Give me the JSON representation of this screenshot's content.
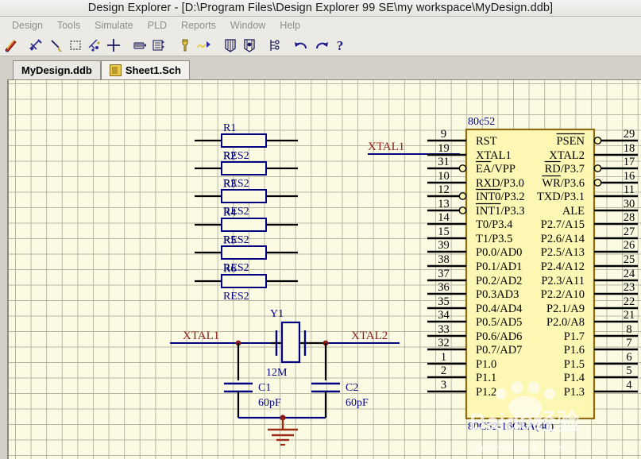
{
  "window": {
    "title": "Design Explorer - [D:\\Program Files\\Design Explorer 99 SE\\my workspace\\MyDesign.ddb]"
  },
  "menubar": {
    "items": [
      {
        "label": "Design"
      },
      {
        "label": "Tools"
      },
      {
        "label": "Simulate"
      },
      {
        "label": "PLD"
      },
      {
        "label": "Reports"
      },
      {
        "label": "Window"
      },
      {
        "label": "Help"
      }
    ]
  },
  "toolbar": {
    "buttons": [
      {
        "name": "wiring-pen-icon"
      },
      {
        "name": "place-wire-icon"
      },
      {
        "name": "place-line-icon"
      },
      {
        "name": "selection-rectangle-icon"
      },
      {
        "name": "place-junction-icon"
      },
      {
        "name": "move-crosshair-icon"
      },
      {
        "name": "netlist-icon"
      },
      {
        "name": "simulation-setup-icon"
      },
      {
        "name": "probe-icon"
      },
      {
        "name": "waveform-icon"
      },
      {
        "name": "pld-compile-icon"
      },
      {
        "name": "pld-download-icon"
      },
      {
        "name": "hierarchy-icon"
      },
      {
        "name": "undo-icon"
      },
      {
        "name": "redo-icon"
      },
      {
        "name": "help-icon"
      }
    ]
  },
  "tabs": [
    {
      "label": "MyDesign.ddb",
      "icon": "",
      "active": false
    },
    {
      "label": "Sheet1.Sch",
      "icon": "schematic-icon",
      "active": true
    }
  ],
  "schematic": {
    "resistors": [
      {
        "designator": "R1",
        "value": "RES2"
      },
      {
        "designator": "R2",
        "value": "RES2"
      },
      {
        "designator": "R3",
        "value": "RES2"
      },
      {
        "designator": "R4",
        "value": "RES2"
      },
      {
        "designator": "R5",
        "value": "RES2"
      },
      {
        "designator": "R6",
        "value": "RES2"
      }
    ],
    "crystal": {
      "designator": "Y1",
      "value": "12M"
    },
    "capacitors": [
      {
        "designator": "C1",
        "value": "60pF"
      },
      {
        "designator": "C2",
        "value": "60pF"
      }
    ],
    "net_labels": [
      {
        "label": "XTAL1",
        "at": "mcu-pin-19"
      },
      {
        "label": "XTAL1",
        "at": "osc-left"
      },
      {
        "label": "XTAL2",
        "at": "osc-right"
      }
    ],
    "ic": {
      "designator": "80c52",
      "part_number": "80C52-16CBA(40)",
      "left_pins": [
        {
          "num": "9",
          "label": "RST",
          "overbar": "",
          "inverted": false
        },
        {
          "num": "19",
          "label": "XTAL1",
          "overbar": "",
          "inverted": false
        },
        {
          "num": "31",
          "label": "EA/VPP",
          "overbar": "EA",
          "inverted": true
        },
        {
          "num": "10",
          "label": "RXD/P3.0",
          "overbar": "",
          "inverted": false
        },
        {
          "num": "12",
          "label": "INT0/P3.2",
          "overbar": "INT0",
          "inverted": true
        },
        {
          "num": "13",
          "label": "INT1/P3.3",
          "overbar": "INT1",
          "inverted": true
        },
        {
          "num": "14",
          "label": "T0/P3.4",
          "overbar": "",
          "inverted": false
        },
        {
          "num": "15",
          "label": "T1/P3.5",
          "overbar": "",
          "inverted": false
        },
        {
          "num": "39",
          "label": "P0.0/AD0",
          "overbar": "",
          "inverted": false
        },
        {
          "num": "38",
          "label": "P0.1/AD1",
          "overbar": "",
          "inverted": false
        },
        {
          "num": "37",
          "label": "P0.2/AD2",
          "overbar": "",
          "inverted": false
        },
        {
          "num": "36",
          "label": "P0.3AD3",
          "overbar": "",
          "inverted": false
        },
        {
          "num": "35",
          "label": "P0.4/AD4",
          "overbar": "",
          "inverted": false
        },
        {
          "num": "34",
          "label": "P0.5/AD5",
          "overbar": "",
          "inverted": false
        },
        {
          "num": "33",
          "label": "P0.6/AD6",
          "overbar": "",
          "inverted": false
        },
        {
          "num": "32",
          "label": "P0.7/AD7",
          "overbar": "",
          "inverted": false
        },
        {
          "num": "1",
          "label": "P1.0",
          "overbar": "",
          "inverted": false
        },
        {
          "num": "2",
          "label": "P1.1",
          "overbar": "",
          "inverted": false
        },
        {
          "num": "3",
          "label": "P1.2",
          "overbar": "",
          "inverted": false
        }
      ],
      "right_pins": [
        {
          "num": "29",
          "label": "PSEN",
          "overbar": "PSEN",
          "inverted": true
        },
        {
          "num": "18",
          "label": "XTAL2",
          "overbar": "",
          "inverted": false
        },
        {
          "num": "17",
          "label": "RD/P3.7",
          "overbar": "RD",
          "inverted": true
        },
        {
          "num": "16",
          "label": "WR/P3.6",
          "overbar": "WR",
          "inverted": true
        },
        {
          "num": "11",
          "label": "TXD/P3.1",
          "overbar": "",
          "inverted": false
        },
        {
          "num": "30",
          "label": "ALE",
          "overbar": "",
          "inverted": false
        },
        {
          "num": "28",
          "label": "P2.7/A15",
          "overbar": "",
          "inverted": false
        },
        {
          "num": "27",
          "label": "P2.6/A14",
          "overbar": "",
          "inverted": false
        },
        {
          "num": "26",
          "label": "P2.5/A13",
          "overbar": "",
          "inverted": false
        },
        {
          "num": "25",
          "label": "P2.4/A12",
          "overbar": "",
          "inverted": false
        },
        {
          "num": "24",
          "label": "P2.3/A11",
          "overbar": "",
          "inverted": false
        },
        {
          "num": "23",
          "label": "P2.2/A10",
          "overbar": "",
          "inverted": false
        },
        {
          "num": "22",
          "label": "P2.1/A9",
          "overbar": "",
          "inverted": false
        },
        {
          "num": "21",
          "label": "P2.0/A8",
          "overbar": "",
          "inverted": false
        },
        {
          "num": "8",
          "label": "P1.7",
          "overbar": "",
          "inverted": false
        },
        {
          "num": "7",
          "label": "P1.6",
          "overbar": "",
          "inverted": false
        },
        {
          "num": "6",
          "label": "P1.5",
          "overbar": "",
          "inverted": false
        },
        {
          "num": "5",
          "label": "P1.4",
          "overbar": "",
          "inverted": false
        },
        {
          "num": "4",
          "label": "P1.3",
          "overbar": "",
          "inverted": false
        }
      ]
    },
    "watermark": {
      "main": "Baidu经验",
      "sub": "jingyan.baidu.com"
    }
  },
  "colors": {
    "canvas_bg": "#fbfbe4",
    "grid": "#b9b7a4",
    "wire": "#000000",
    "component_outline": "#000080",
    "net_label": "#8b2020",
    "ic_fill": "#fdf7b4",
    "ic_outline": "#8b6b14",
    "ground": "#9c2b13"
  }
}
